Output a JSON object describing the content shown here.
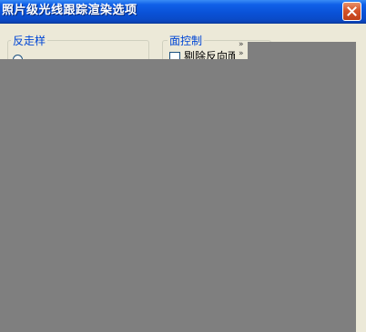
{
  "window": {
    "title": "照片级光线跟踪渲染选项",
    "close_label": "×"
  },
  "groups": {
    "antialias": {
      "label": "反走样"
    },
    "face_control": {
      "label": "面控制",
      "checkbox_label": "剔除反向面",
      "checked": false
    }
  },
  "icons": {
    "close": "close-icon",
    "radio": "radio-button",
    "checkbox": "checkbox",
    "arrow": "expand-arrow-icon"
  }
}
